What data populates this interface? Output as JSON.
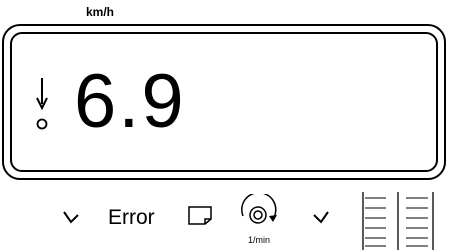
{
  "display": {
    "unit": "km/h",
    "value": "6.9"
  },
  "function_bar": {
    "error_label": "Error",
    "rpm_unit": "1/min"
  },
  "icons": [
    "alarm-marker-icon",
    "arrow-left-icon",
    "tray-icon",
    "rpm-sensor-icon",
    "arrow-right-icon",
    "level-gauge-icon"
  ]
}
